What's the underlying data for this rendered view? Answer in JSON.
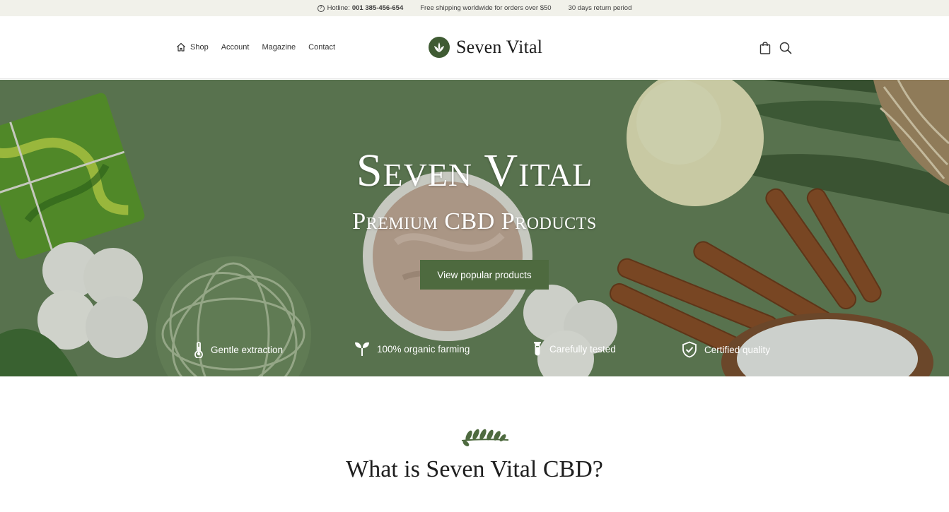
{
  "topbar": {
    "hotline_label": "Hotline:",
    "hotline_number": "001 385-456-654",
    "shipping": "Free shipping worldwide for orders over $50",
    "returns": "30 days return period"
  },
  "nav": {
    "items": [
      {
        "label": "Shop",
        "icon": "home-icon"
      },
      {
        "label": "Account"
      },
      {
        "label": "Magazine"
      },
      {
        "label": "Contact"
      }
    ]
  },
  "logo": {
    "text": "Seven Vital",
    "icon": "leaf-icon"
  },
  "header_icons": [
    "shopping-bag-icon",
    "search-icon"
  ],
  "hero": {
    "title": "Seven Vital",
    "subtitle": "Premium CBD Products",
    "cta": "View popular products",
    "features": [
      {
        "label": "Gentle extraction",
        "icon": "thermometer-icon"
      },
      {
        "label": "100% organic farming",
        "icon": "sprout-icon"
      },
      {
        "label": "Carefully tested",
        "icon": "test-tube-icon"
      },
      {
        "label": "Certified quality",
        "icon": "shield-check-icon"
      }
    ]
  },
  "section": {
    "icon": "leaves-icon",
    "title": "What is Seven Vital CBD?"
  },
  "colors": {
    "accent": "#4e6a3f",
    "topbar_bg": "#f1f1ea",
    "hero_bg": "#5f7b55"
  }
}
